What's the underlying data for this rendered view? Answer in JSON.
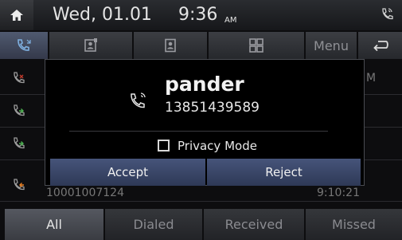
{
  "status_bar": {
    "date": "Wed, 01.01",
    "time": "9:36",
    "ampm": "AM",
    "icons": [
      "home-icon",
      "phone-connected-icon"
    ]
  },
  "toolbar": {
    "menu_label": "Menu",
    "icons": [
      "call-history-icon",
      "contacts-icon",
      "phonebook-icon",
      "dialpad-icon",
      "back-icon"
    ]
  },
  "call_list": {
    "partial_texts": {
      "row1_right": "M",
      "row4_number": "10001007124",
      "row4_time": "9:10:21"
    }
  },
  "incoming_call": {
    "caller_name": "pander",
    "caller_number": "13851439589",
    "privacy_mode_label": "Privacy Mode",
    "privacy_mode_checked": false,
    "accept_label": "Accept",
    "reject_label": "Reject"
  },
  "tabs": {
    "all": "All",
    "dialed": "Dialed",
    "received": "Received",
    "missed": "Missed",
    "active": "All"
  },
  "colors": {
    "button_accent": "#3a4766",
    "missed_call": "#c0392b",
    "received_call": "#4caf50",
    "active_tab": "#555860"
  }
}
